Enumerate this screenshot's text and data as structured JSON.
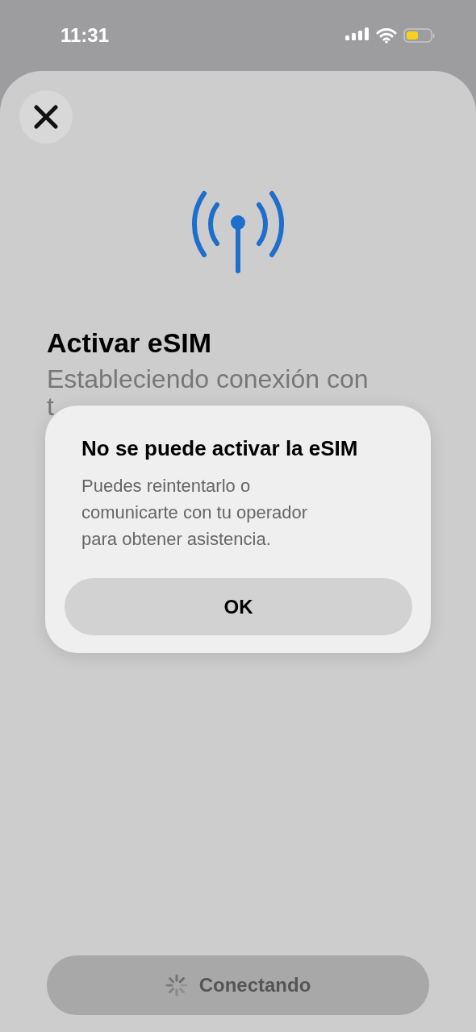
{
  "status_bar": {
    "time": "11:31"
  },
  "sheet": {
    "title": "Activar eSIM",
    "subtitle": "Estableciendo conexión con",
    "subtitle_visible_tail": "t"
  },
  "alert": {
    "title": "No se puede activar la eSIM",
    "message": "Puedes reintentarlo o comunicarte con tu operador para obtener asistencia.",
    "button": "OK"
  },
  "bottom_button": {
    "label": "Conectando",
    "disabled": true
  }
}
